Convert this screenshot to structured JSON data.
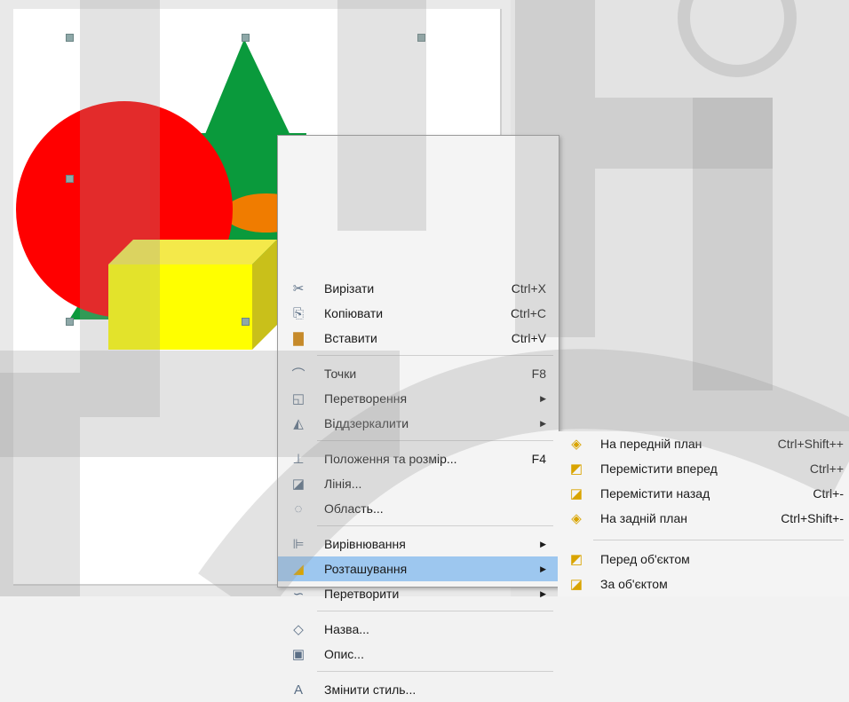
{
  "canvas": {
    "colors": {
      "circle": "#ff0000",
      "triangle": "#0a9a3c",
      "box_front": "#ffff00",
      "box_top": "#f4e94a",
      "box_side": "#c9c01a",
      "orange": "#f07c00"
    }
  },
  "context_menu": {
    "items": [
      {
        "label": "Вирізати",
        "shortcut": "Ctrl+X",
        "icon": "scissors-icon"
      },
      {
        "label": "Копіювати",
        "shortcut": "Ctrl+C",
        "icon": "copy-icon"
      },
      {
        "label": "Вставити",
        "shortcut": "Ctrl+V",
        "icon": "paste-icon"
      },
      {
        "label": "Точки",
        "shortcut": "F8",
        "icon": "points-icon"
      },
      {
        "label": "Перетворення",
        "shortcut": "",
        "icon": "transform-icon",
        "submenu": true
      },
      {
        "label": "Віддзеркалити",
        "shortcut": "",
        "icon": "flip-icon",
        "submenu": true
      },
      {
        "label": "Положення та розмір...",
        "shortcut": "F4",
        "icon": "position-size-icon"
      },
      {
        "label": "Лінія...",
        "shortcut": "",
        "icon": "line-icon"
      },
      {
        "label": "Область...",
        "shortcut": "",
        "icon": "area-icon"
      },
      {
        "label": "Вирівнювання",
        "shortcut": "",
        "icon": "align-icon",
        "submenu": true
      },
      {
        "label": "Розташування",
        "shortcut": "",
        "icon": "arrange-icon",
        "submenu": true,
        "active": true
      },
      {
        "label": "Перетворити",
        "shortcut": "",
        "icon": "convert-icon",
        "submenu": true
      },
      {
        "label": "Назва...",
        "shortcut": "",
        "icon": "name-icon"
      },
      {
        "label": "Опис...",
        "shortcut": "",
        "icon": "description-icon"
      },
      {
        "label": "Змінити стиль...",
        "shortcut": "",
        "icon": "style-icon"
      }
    ]
  },
  "arrange_submenu": {
    "items": [
      {
        "label": "На передній план",
        "shortcut": "Ctrl+Shift++",
        "icon": "bring-to-front-icon"
      },
      {
        "label": "Перемістити вперед",
        "shortcut": "Ctrl++",
        "icon": "bring-forward-icon"
      },
      {
        "label": "Перемістити назад",
        "shortcut": "Ctrl+-",
        "icon": "send-backward-icon"
      },
      {
        "label": "На задній план",
        "shortcut": "Ctrl+Shift+-",
        "icon": "send-to-back-icon"
      },
      {
        "label": "Перед об'єктом",
        "shortcut": "",
        "icon": "in-front-of-object-icon"
      },
      {
        "label": "За об'єктом",
        "shortcut": "",
        "icon": "behind-object-icon"
      }
    ]
  }
}
